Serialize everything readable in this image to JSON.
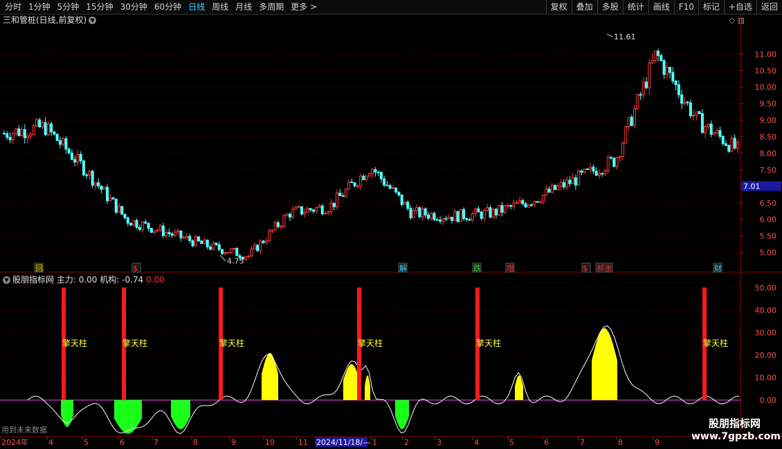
{
  "toolbar": {
    "left_items": [
      "分时",
      "1分钟",
      "5分钟",
      "15分钟",
      "30分钟",
      "60分钟",
      "日线",
      "周线",
      "月线",
      "多周期",
      "更多 >"
    ],
    "active_index": 6,
    "right_items": [
      "复权",
      "叠加",
      "多股",
      "统计",
      "画线",
      "F10",
      "标记",
      "+自选",
      "返回"
    ]
  },
  "chart_title": "三和管桩(日线,前复权)",
  "title_icons": "◇ ▥",
  "price_axis": {
    "ticks": [
      "11.00",
      "10.50",
      "10.00",
      "9.50",
      "9.00",
      "8.50",
      "8.00",
      "7.50",
      "6.50",
      "6.00",
      "5.50",
      "5.00"
    ],
    "current_price": "7.01",
    "high_label": "11.61",
    "low_label": "4.75"
  },
  "event_markers": [
    {
      "text": "回",
      "color": "#ffd400"
    },
    {
      "text": "$",
      "color": "#ff3030"
    },
    {
      "text": "解",
      "color": "#37d4ff"
    },
    {
      "text": "跌",
      "color": "#30e030"
    },
    {
      "text": "增",
      "color": "#ff3030"
    },
    {
      "text": "$",
      "color": "#ff3030"
    },
    {
      "text": "郝涨",
      "color": "#ff3030"
    },
    {
      "text": "财",
      "color": "#37d4ff"
    }
  ],
  "indicator": {
    "name": "股朋指标网",
    "main_label": "主力:",
    "main_value": "0.00",
    "inst_label": "机构:",
    "inst_value": "-0.74",
    "extra_value": "0.00",
    "axis_ticks": [
      "50.00",
      "40.00",
      "30.00",
      "20.00",
      "10.00",
      "0.00"
    ],
    "pillar_label": "擎天柱"
  },
  "chart_data": {
    "type": "line",
    "series": [
      {
        "x": [
          "2024-03",
          "2024-04",
          "2024-05",
          "2024-06",
          "2024-07",
          "2024-08",
          "2024-09",
          "2024-10",
          "2024-11",
          "2024-12",
          "2025-01",
          "2025-02",
          "2025-03",
          "2025-04",
          "2025-05",
          "2025-06",
          "2025-07",
          "2025-08",
          "2025-09"
        ],
        "values": [
          8.6,
          8.8,
          7.5,
          6.0,
          5.6,
          5.2,
          4.9,
          6.2,
          6.4,
          7.6,
          6.2,
          6.1,
          6.2,
          6.6,
          7.2,
          7.8,
          11.0,
          9.0,
          8.1
        ]
      }
    ],
    "ylim": [
      4.7,
      11.8
    ],
    "x_tick_labels": [
      "2024年",
      "4",
      "5",
      "6",
      "7",
      "8",
      "9",
      "10",
      "11",
      "2024/11/18/—",
      "1",
      "2",
      "3",
      "4",
      "5",
      "6",
      "7",
      "8",
      "9"
    ],
    "indicator_ylim": [
      -15,
      55
    ],
    "pillars": [
      {
        "value": 50
      },
      {
        "value": 50
      },
      {
        "value": 50
      },
      {
        "value": 50
      },
      {
        "value": 50
      },
      {
        "value": 50
      }
    ]
  },
  "footer": {
    "future_note": "用到未来数据",
    "watermark_title": "股朋指标网",
    "watermark_url": "www.7gpzb.com"
  },
  "colors": {
    "up": "#ff3a3a",
    "down": "#54ffff",
    "pillar": "#ff1a1a",
    "pos_fill": "#ffff00",
    "neg_fill": "#1aff1a",
    "grid": "#7a0000"
  }
}
